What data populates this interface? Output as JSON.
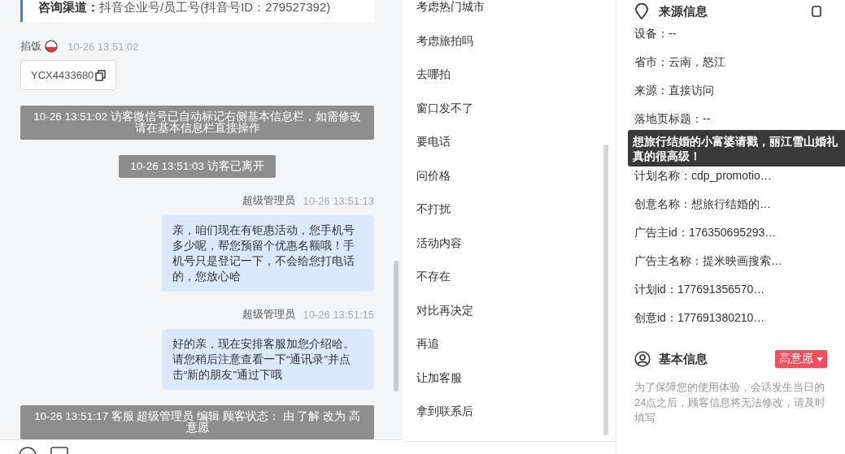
{
  "chat": {
    "channel": "**咨询渠道：**抖音企业号/员工号(抖音号ID：279527392)",
    "messages": [
      {
        "kind": "visitor",
        "name": "掐饭",
        "time": "10-26 13:51:02",
        "code": "YCX4433680"
      },
      {
        "kind": "system",
        "text": "10-26 13:51:02 访客微信号已自动标记右侧基本信息栏，如需修改请在基本信息栏直接操作"
      },
      {
        "kind": "system",
        "text": "10-26 13:51:03 访客已离开"
      },
      {
        "kind": "agent",
        "name": "超级管理员",
        "time": "10-26 13:51:13",
        "text": "亲，咱们现在有钜惠活动，您手机号多少呢，帮您预留个优惠名额哦！手机号只是登记一下，不会给您打电话的，您放心哈"
      },
      {
        "kind": "agent",
        "name": "超级管理员",
        "time": "10-26 13:51:15",
        "text": "好的亲，现在安排客服加您介绍哈。请您稍后注意查看一下“通讯录”并点击“新的朋友”通过下哦"
      },
      {
        "kind": "system",
        "text": "10-26 13:51:17 客服 超级管理员 编辑 顾客状态： 由 了解 改为 高意愿"
      }
    ]
  },
  "quick_replies": [
    "考虑热门城市",
    "考虑旅拍吗",
    "去哪拍",
    "窗口发不了",
    "要电话",
    "问价格",
    "不打扰",
    "活动内容",
    "不存在",
    "对比再决定",
    "再追",
    "让加客服",
    "拿到联系后"
  ],
  "source_info": {
    "title": "来源信息",
    "fields": [
      "设备：--",
      "省市：云南，怒江",
      "来源：直接访问",
      "落地页标题：--"
    ],
    "tooltip": "想旅行结婚的小富婆请戳，丽江雪山婚礼真的很高级！",
    "fields_below": [
      "计划名称：cdp_promotio…",
      "创意名称：想旅行结婚的…",
      "广告主id：176350695293…",
      "广告主名称：提米映画搜索…",
      "计划id：177691356570…",
      "创意id：177691380210…"
    ]
  },
  "basic_info": {
    "title": "基本信息",
    "intent": "高意愿",
    "note": "为了保障您的使用体验，会话发生当日的24点之后，顾客信息将无法修改，请及时填写"
  }
}
